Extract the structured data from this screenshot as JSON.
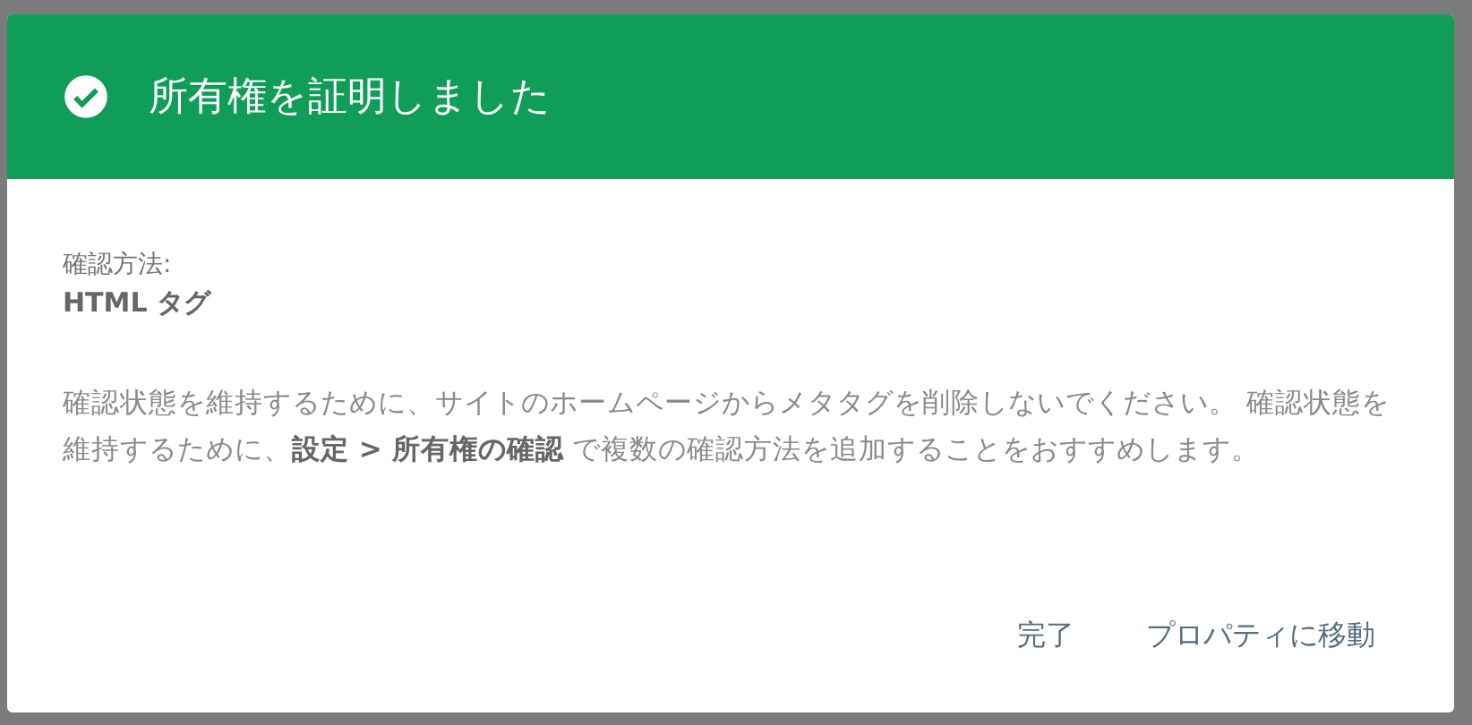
{
  "dialog": {
    "title": "所有権を証明しました",
    "method_label": "確認方法:",
    "method_value": "HTML タグ",
    "message": "確認状態を維持するために、サイトのホームページからメタタグを削除しないでください。 確認状態を維持するために、**設定 > 所有権の確認** で複数の確認方法を追加することをおすすめします。",
    "buttons": [
      "完了",
      "プロパティに移動"
    ]
  }
}
